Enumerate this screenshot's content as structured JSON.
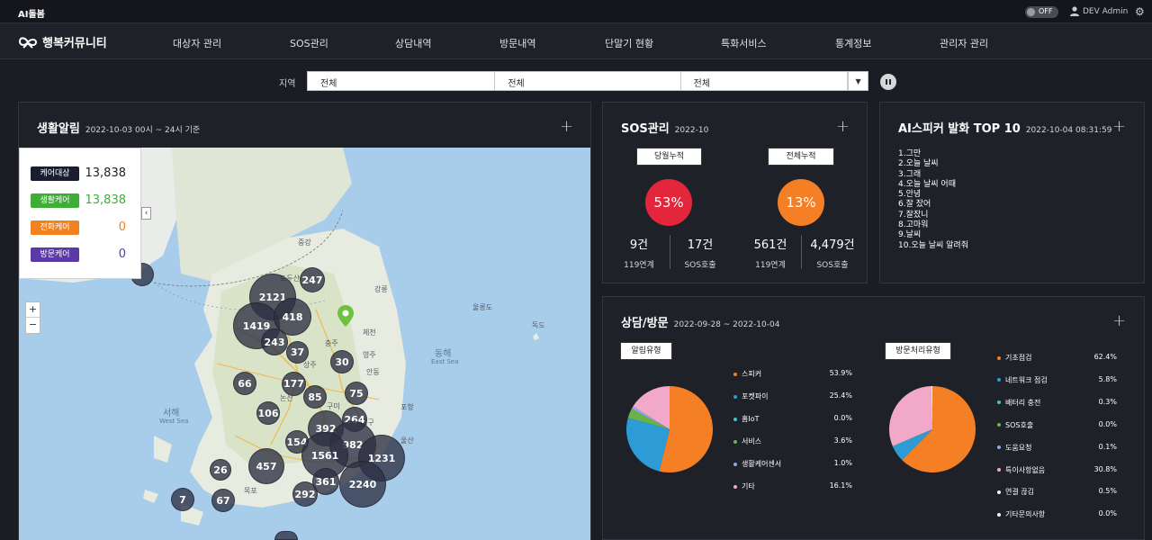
{
  "topbar": {
    "brand": "AI돌봄",
    "toggle": "OFF",
    "user": "DEV Admin"
  },
  "logo": {
    "text": "행복커뮤니티"
  },
  "nav": [
    "대상자 관리",
    "SOS관리",
    "상담내역",
    "방문내역",
    "단말기 현황",
    "특화서비스",
    "통계정보",
    "관리자 관리"
  ],
  "filter": {
    "label": "지역",
    "values": [
      "전체",
      "전체",
      "전체"
    ]
  },
  "life": {
    "title": "생활알림",
    "sub": "2022-10-03 00시 ~ 24시 기준",
    "legend": [
      {
        "tag": "케어대상",
        "value": "13,838",
        "color": "#1b1e2e",
        "vcolor": "#222222"
      },
      {
        "tag": "생활케어",
        "value": "13,838",
        "color": "#3fae37",
        "vcolor": "#3fae37"
      },
      {
        "tag": "전화케어",
        "value": "0",
        "color": "#f0821f",
        "vcolor": "#f0821f"
      },
      {
        "tag": "방문케어",
        "value": "0",
        "color": "#5b3aa8",
        "vcolor": "#5b3aa8"
      }
    ],
    "map_labels": [
      "중강",
      "도두산",
      "강릉",
      "동해",
      "East Sea",
      "울릉도",
      "독도",
      "서해",
      "West Sea",
      "제천",
      "충주",
      "영주",
      "안동",
      "구미",
      "대구",
      "울산",
      "목포",
      "포항",
      "상주",
      "논산"
    ],
    "clusters": [
      {
        "label": "2121"
      },
      {
        "label": "247"
      },
      {
        "label": "1419"
      },
      {
        "label": "418"
      },
      {
        "label": "243"
      },
      {
        "label": "37"
      },
      {
        "label": "30"
      },
      {
        "label": "66"
      },
      {
        "label": "177"
      },
      {
        "label": "85"
      },
      {
        "label": "75"
      },
      {
        "label": "106"
      },
      {
        "label": "392"
      },
      {
        "label": "264"
      },
      {
        "label": "154"
      },
      {
        "label": "982"
      },
      {
        "label": "1561"
      },
      {
        "label": "1231"
      },
      {
        "label": "457"
      },
      {
        "label": "26"
      },
      {
        "label": "361"
      },
      {
        "label": "2240"
      },
      {
        "label": "292"
      },
      {
        "label": "7"
      },
      {
        "label": "67"
      },
      {
        "label": ""
      },
      {
        "label": ""
      }
    ]
  },
  "sos": {
    "title": "SOS관리",
    "sub": "2022-10",
    "monthly": {
      "label": "당월누적",
      "pct": "53%",
      "color": "#e3263b",
      "a_num": "9건",
      "a_lbl": "119연계",
      "b_num": "17건",
      "b_lbl": "SOS호출"
    },
    "total": {
      "label": "전체누적",
      "pct": "13%",
      "color": "#f47f25",
      "a_num": "561건",
      "a_lbl": "119연계",
      "b_num": "4,479건",
      "b_lbl": "SOS호출"
    }
  },
  "top10": {
    "title": "AI스피커 발화 TOP 10",
    "sub": "2022-10-04 08:31:59",
    "items": [
      "1.그만",
      "2.오늘 날씨",
      "3.그래",
      "4.오늘 날씨 어때",
      "5.안녕",
      "6.잘 잤어",
      "7.잘잤니",
      "8.고마워",
      "9.날씨",
      "10.오늘 날씨 알려줘"
    ]
  },
  "consult": {
    "title": "상담/방문",
    "sub": "2022-09-28 ~ 2022-10-04",
    "alarm_label": "알림유형",
    "visit_label": "방문처리유형"
  },
  "chart_data": [
    {
      "type": "pie",
      "title": "알림유형",
      "categories": [
        "스피커",
        "포켓파이",
        "홈IoT",
        "서비스",
        "생활케어센서",
        "기타"
      ],
      "values": [
        53.9,
        25.4,
        0.0,
        3.6,
        1.0,
        16.1
      ],
      "labels": [
        "53.9%",
        "25.4%",
        "0.0%",
        "3.6%",
        "1.0%",
        "16.1%"
      ],
      "colors": [
        "#f47f25",
        "#2d9bd6",
        "#3cc6c6",
        "#6cb24a",
        "#8fa7e8",
        "#f2a8c8"
      ]
    },
    {
      "type": "pie",
      "title": "방문처리유형",
      "categories": [
        "기초점검",
        "네트워크 점검",
        "배터리 충전",
        "SOS호출",
        "도움요청",
        "특이사항없음",
        "연결 끊김",
        "기타문의사항"
      ],
      "values": [
        62.4,
        5.8,
        0.3,
        0.0,
        0.1,
        30.8,
        0.5,
        0.0
      ],
      "labels": [
        "62.4%",
        "5.8%",
        "0.3%",
        "0.0%",
        "0.1%",
        "30.8%",
        "0.5%",
        "0.0%"
      ],
      "colors": [
        "#f47f25",
        "#2d9bd6",
        "#3cc6c6",
        "#6cb24a",
        "#8fa7e8",
        "#f2a8c8",
        "#f2f2f2",
        "#f2f2f2"
      ]
    }
  ]
}
